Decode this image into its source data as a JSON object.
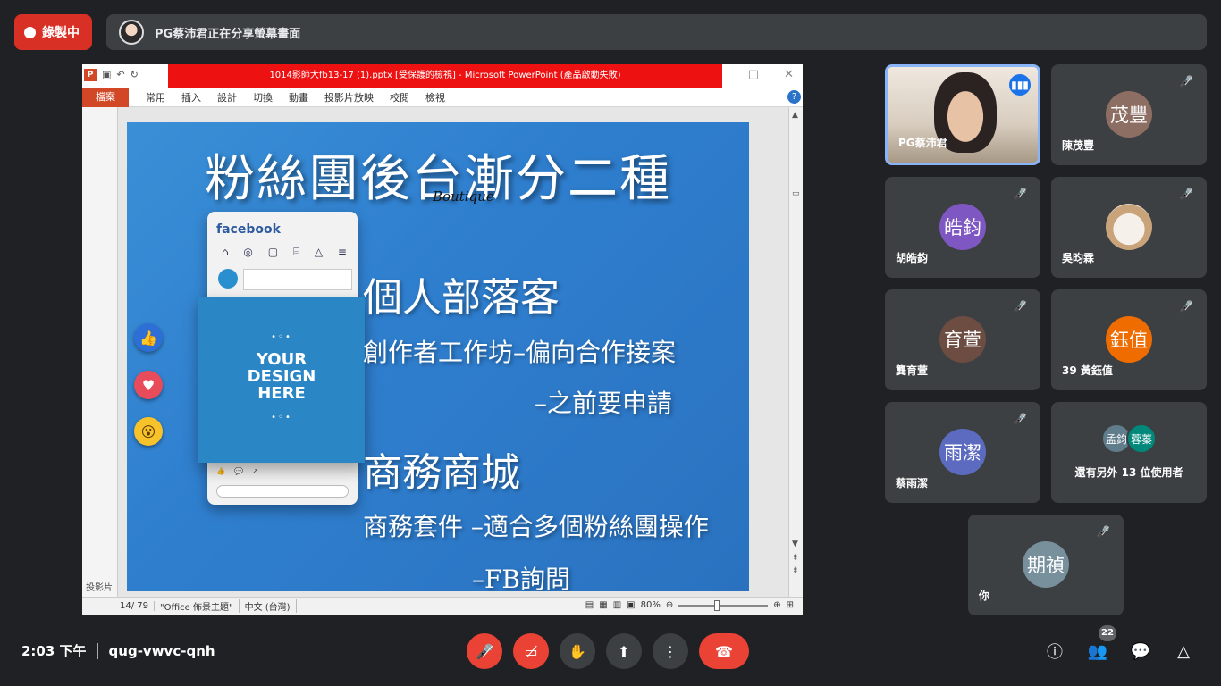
{
  "recording": {
    "label": "錄製中"
  },
  "share_banner": {
    "text": "PG蔡沛君正在分享螢幕畫面"
  },
  "ppt": {
    "window_title": "1014影師大fb13-17 (1).pptx [受保護的檢視] - Microsoft PowerPoint (產品啟動失敗)",
    "file_tab": "檔案",
    "tabs": [
      "常用",
      "插入",
      "設計",
      "切換",
      "動畫",
      "投影片放映",
      "校閱",
      "檢視"
    ],
    "left_pane_label": "投影片",
    "status": {
      "slide": "14/ 79",
      "theme": "\"Office 佈景主題\"",
      "lang": "中文 (台灣)",
      "zoom": "80%"
    }
  },
  "slide": {
    "title": "粉絲團後台漸分二種",
    "boutique": "Boutique",
    "fb_brand": "facebook",
    "design_text": [
      "YOUR",
      "DESIGN",
      "HERE"
    ],
    "heading1": "個人部落客",
    "line1": "創作者工作坊–偏向合作接案",
    "line2": "–之前要申請",
    "heading2": "商務商城",
    "line3": "商務套件 –適合多個粉絲團操作",
    "line4": "–FB詢問"
  },
  "participants": [
    {
      "name": "PG蔡沛君",
      "avatar": "",
      "color": ""
    },
    {
      "name": "陳茂豐",
      "avatar": "茂豐",
      "color": "#8d6e63"
    },
    {
      "name": "胡皓鈞",
      "avatar": "皓鈞",
      "color": "#7e57c2"
    },
    {
      "name": "吳昀霖",
      "avatar": "",
      "color": ""
    },
    {
      "name": "龔育萱",
      "avatar": "育萱",
      "color": "#6d4c41"
    },
    {
      "name": "39 黃鈺值",
      "avatar": "鈺值",
      "color": "#ef6c00"
    },
    {
      "name": "蔡雨潔",
      "avatar": "雨潔",
      "color": "#5c6bc0"
    },
    {
      "name": "你",
      "avatar": "期禎",
      "color": "#78909c"
    }
  ],
  "others": {
    "label": "還有另外 13 位使用者",
    "a1": "孟鈞",
    "a2": "蓉蓁",
    "c1": "#607d8b",
    "c2": "#00897b"
  },
  "meeting": {
    "time": "2:03 下午",
    "code": "qug-vwvc-qnh",
    "people_count": "22"
  }
}
